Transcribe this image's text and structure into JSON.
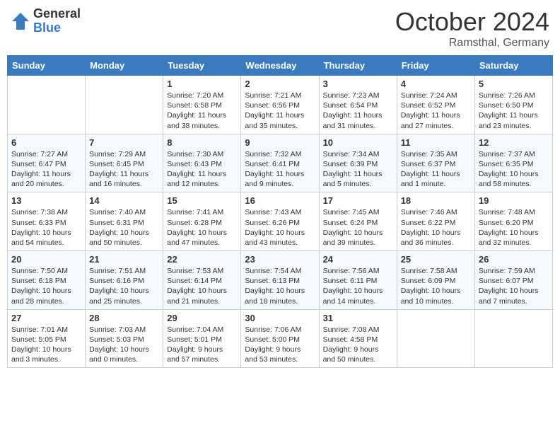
{
  "header": {
    "logo_general": "General",
    "logo_blue": "Blue",
    "month_title": "October 2024",
    "subtitle": "Ramsthal, Germany"
  },
  "weekdays": [
    "Sunday",
    "Monday",
    "Tuesday",
    "Wednesday",
    "Thursday",
    "Friday",
    "Saturday"
  ],
  "weeks": [
    [
      {
        "day": "",
        "info": ""
      },
      {
        "day": "",
        "info": ""
      },
      {
        "day": "1",
        "info": "Sunrise: 7:20 AM\nSunset: 6:58 PM\nDaylight: 11 hours and 38 minutes."
      },
      {
        "day": "2",
        "info": "Sunrise: 7:21 AM\nSunset: 6:56 PM\nDaylight: 11 hours and 35 minutes."
      },
      {
        "day": "3",
        "info": "Sunrise: 7:23 AM\nSunset: 6:54 PM\nDaylight: 11 hours and 31 minutes."
      },
      {
        "day": "4",
        "info": "Sunrise: 7:24 AM\nSunset: 6:52 PM\nDaylight: 11 hours and 27 minutes."
      },
      {
        "day": "5",
        "info": "Sunrise: 7:26 AM\nSunset: 6:50 PM\nDaylight: 11 hours and 23 minutes."
      }
    ],
    [
      {
        "day": "6",
        "info": "Sunrise: 7:27 AM\nSunset: 6:47 PM\nDaylight: 11 hours and 20 minutes."
      },
      {
        "day": "7",
        "info": "Sunrise: 7:29 AM\nSunset: 6:45 PM\nDaylight: 11 hours and 16 minutes."
      },
      {
        "day": "8",
        "info": "Sunrise: 7:30 AM\nSunset: 6:43 PM\nDaylight: 11 hours and 12 minutes."
      },
      {
        "day": "9",
        "info": "Sunrise: 7:32 AM\nSunset: 6:41 PM\nDaylight: 11 hours and 9 minutes."
      },
      {
        "day": "10",
        "info": "Sunrise: 7:34 AM\nSunset: 6:39 PM\nDaylight: 11 hours and 5 minutes."
      },
      {
        "day": "11",
        "info": "Sunrise: 7:35 AM\nSunset: 6:37 PM\nDaylight: 11 hours and 1 minute."
      },
      {
        "day": "12",
        "info": "Sunrise: 7:37 AM\nSunset: 6:35 PM\nDaylight: 10 hours and 58 minutes."
      }
    ],
    [
      {
        "day": "13",
        "info": "Sunrise: 7:38 AM\nSunset: 6:33 PM\nDaylight: 10 hours and 54 minutes."
      },
      {
        "day": "14",
        "info": "Sunrise: 7:40 AM\nSunset: 6:31 PM\nDaylight: 10 hours and 50 minutes."
      },
      {
        "day": "15",
        "info": "Sunrise: 7:41 AM\nSunset: 6:28 PM\nDaylight: 10 hours and 47 minutes."
      },
      {
        "day": "16",
        "info": "Sunrise: 7:43 AM\nSunset: 6:26 PM\nDaylight: 10 hours and 43 minutes."
      },
      {
        "day": "17",
        "info": "Sunrise: 7:45 AM\nSunset: 6:24 PM\nDaylight: 10 hours and 39 minutes."
      },
      {
        "day": "18",
        "info": "Sunrise: 7:46 AM\nSunset: 6:22 PM\nDaylight: 10 hours and 36 minutes."
      },
      {
        "day": "19",
        "info": "Sunrise: 7:48 AM\nSunset: 6:20 PM\nDaylight: 10 hours and 32 minutes."
      }
    ],
    [
      {
        "day": "20",
        "info": "Sunrise: 7:50 AM\nSunset: 6:18 PM\nDaylight: 10 hours and 28 minutes."
      },
      {
        "day": "21",
        "info": "Sunrise: 7:51 AM\nSunset: 6:16 PM\nDaylight: 10 hours and 25 minutes."
      },
      {
        "day": "22",
        "info": "Sunrise: 7:53 AM\nSunset: 6:14 PM\nDaylight: 10 hours and 21 minutes."
      },
      {
        "day": "23",
        "info": "Sunrise: 7:54 AM\nSunset: 6:13 PM\nDaylight: 10 hours and 18 minutes."
      },
      {
        "day": "24",
        "info": "Sunrise: 7:56 AM\nSunset: 6:11 PM\nDaylight: 10 hours and 14 minutes."
      },
      {
        "day": "25",
        "info": "Sunrise: 7:58 AM\nSunset: 6:09 PM\nDaylight: 10 hours and 10 minutes."
      },
      {
        "day": "26",
        "info": "Sunrise: 7:59 AM\nSunset: 6:07 PM\nDaylight: 10 hours and 7 minutes."
      }
    ],
    [
      {
        "day": "27",
        "info": "Sunrise: 7:01 AM\nSunset: 5:05 PM\nDaylight: 10 hours and 3 minutes."
      },
      {
        "day": "28",
        "info": "Sunrise: 7:03 AM\nSunset: 5:03 PM\nDaylight: 10 hours and 0 minutes."
      },
      {
        "day": "29",
        "info": "Sunrise: 7:04 AM\nSunset: 5:01 PM\nDaylight: 9 hours and 57 minutes."
      },
      {
        "day": "30",
        "info": "Sunrise: 7:06 AM\nSunset: 5:00 PM\nDaylight: 9 hours and 53 minutes."
      },
      {
        "day": "31",
        "info": "Sunrise: 7:08 AM\nSunset: 4:58 PM\nDaylight: 9 hours and 50 minutes."
      },
      {
        "day": "",
        "info": ""
      },
      {
        "day": "",
        "info": ""
      }
    ]
  ]
}
